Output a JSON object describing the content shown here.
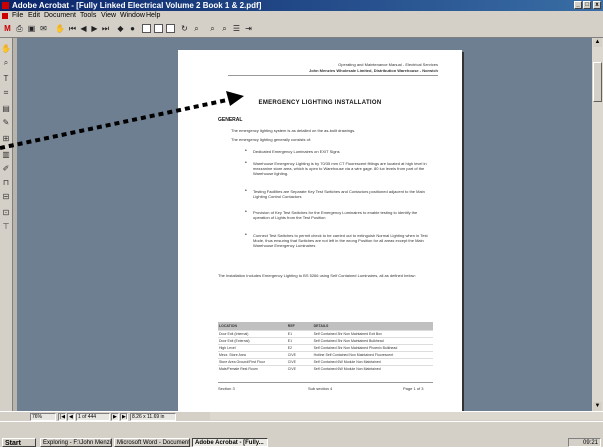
{
  "window": {
    "title": "Adobe Acrobat - [Fully Linked Electrical Volume 2 Book 1 & 2.pdf]",
    "controls": [
      "_",
      "□",
      "x"
    ]
  },
  "menu": [
    "File",
    "Edit",
    "Document",
    "Tools",
    "View",
    "Window",
    "Help"
  ],
  "toolbar": {
    "icons": [
      "open-icon",
      "print-icon",
      "save-icon",
      "email-icon",
      "hand-icon",
      "first-page-icon",
      "previous-page-icon",
      "next-page-icon",
      "last-page-icon",
      "go-back-icon",
      "go-forward-icon",
      "actual-size-icon",
      "fit-page-icon",
      "fit-width-icon",
      "rotate-icon",
      "find-icon",
      "search-icon",
      "search-results-icon",
      "previous-highlight-icon",
      "next-highlight-icon"
    ]
  },
  "document": {
    "header_line1": "Operating and Maintenance Manual - Electrical Services",
    "header_line2": "John Menzies Wholesale Limited, Distribution Warehouse - Norwich",
    "title": "EMERGENCY LIGHTING INSTALLATION",
    "section": "GENERAL",
    "para1": "The emergency lighting system is as detailed on the as-built drawings.",
    "para2": "The emergency lighting generally consists of:",
    "bullets": [
      "Dedicated Emergency Luminaires on EXIT Signs",
      "Warehouse Emergency Lighting is by 70/35 mm CT Fluorescent fittings are located at high level in mezzanine store area, which is open to Warehouse via a wire gage. 80 lux levels from part of the Warehouse lighting.",
      "Testing Facilities are Separate Key Test Switches and Contactors positioned adjacent to the Main Lighting Control Contactors",
      "Provision of Key Test Switches for the Emergency Luminaires to enable testing to identify the operation of Lights from the Test Position",
      "Connect Test Switches to permit check to be carried out to extinguish Normal Lighting when in Test Mode, thus ensuring that Switches are not left in the wrong Position for all areas except the Main Warehouse Emergency Luminaires"
    ],
    "para3": "The Installation Includes Emergency Lighting to BS 5266 using Self Contained Luminaires, all as defined below:",
    "table_headers": [
      "LOCATION",
      "REF",
      "DETAILS"
    ],
    "table_rows": [
      [
        "Door Exit (Internal)",
        "E1",
        "Self Contained 3hr Non Maintained Exit Box"
      ],
      [
        "Door Exit (External)",
        "E1",
        "Self Contained 3hr Non Maintained Bulkhead"
      ],
      [
        "High Level",
        "E2",
        "Self Contained 3hr Non Maintained Phoenix Bulkhead"
      ],
      [
        "Mezz. Store Area",
        "CIVE",
        "Hotline Self Contained Non Maintained Fluorescent"
      ],
      [
        "Store Area Ground/First Floor",
        "CIVE",
        "Self Contained 6W Module Non Maintained"
      ],
      [
        "Male/Female Rest Room",
        "CIVE",
        "Self Contained 6W Module Non Maintained"
      ]
    ],
    "footer_left": "Section 3",
    "footer_mid": "Sub section 4",
    "footer_right": "Page 1 of 3"
  },
  "navbar": {
    "zoom": "76%",
    "page": "1 of 444",
    "size": "8.26 x 11.69 in"
  },
  "taskbar": {
    "start": "Start",
    "tasks": [
      {
        "label": "Exploring - F:\\John Menzie...",
        "active": false
      },
      {
        "label": "Microsoft Word - Document1",
        "active": false
      },
      {
        "label": "Adobe Acrobat - [Fully...",
        "active": true
      }
    ],
    "clock": "09:21"
  }
}
